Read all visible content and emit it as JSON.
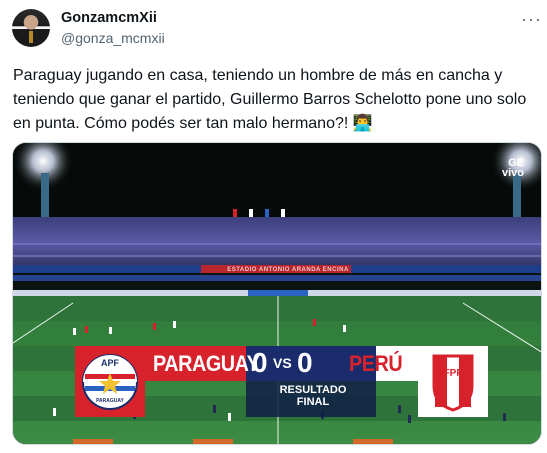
{
  "author": {
    "name": "GonzamcmXii",
    "handle": "@gonza_mcmxii"
  },
  "icons": {
    "more": "more-options-icon",
    "emoji": "man-technologist-emoji-icon"
  },
  "tweet": {
    "text": "Paraguay jugando en casa, teniendo un hombre de más en cancha y teniendo que ganar el partido, Guillermo Barros Schelotto pone uno solo en punta. Cómo podés ser tan malo hermano?! 👨‍💻"
  },
  "media": {
    "banner_text": "ESTADIO ANTONIO ARANDA ENCINA",
    "watermark": "GE\nvivo",
    "scoreboard": {
      "home_team": "PARAGUAY",
      "home_score": "0",
      "vs": "VS",
      "away_score": "0",
      "away_team": "PERÚ",
      "status": "RESULTADO\nFINAL",
      "home_badge": "APF",
      "home_badge_sub": "PARAGUAY",
      "away_badge": "FPF"
    }
  },
  "colors": {
    "paraguay_red": "#d7222b",
    "score_navy": "#1a2c6b",
    "pitch_green": "#2f7a3a"
  }
}
